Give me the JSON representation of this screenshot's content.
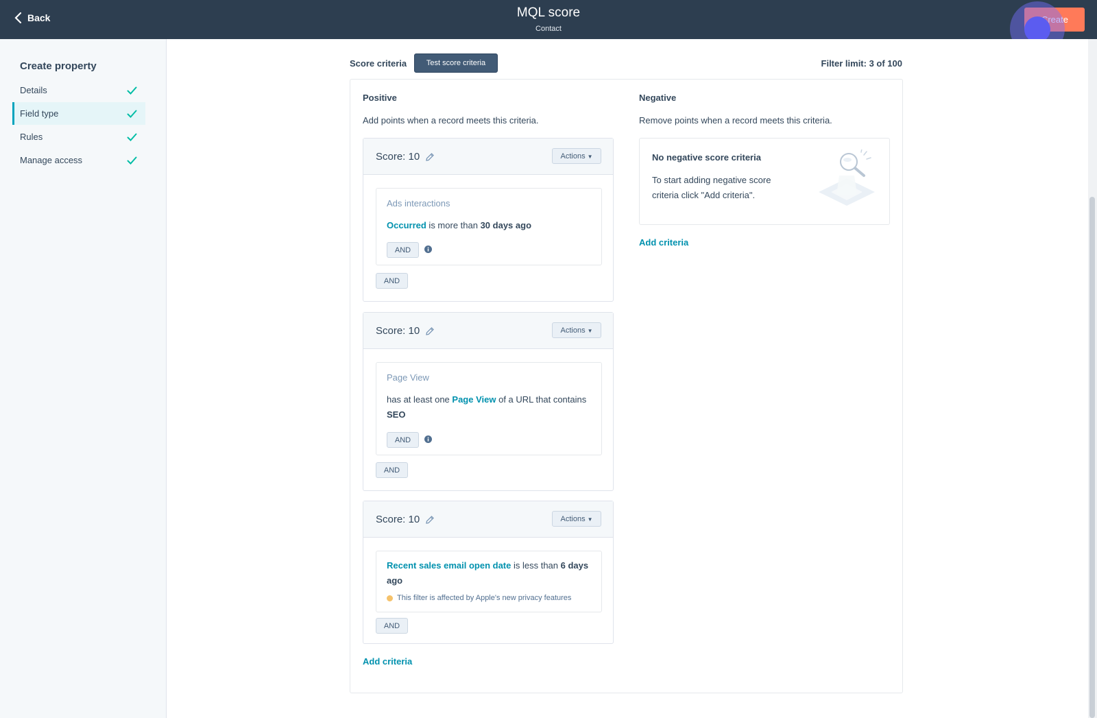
{
  "header": {
    "back_label": "Back",
    "title": "MQL score",
    "subtitle": "Contact",
    "create_label": "Create"
  },
  "sidebar": {
    "title": "Create property",
    "items": [
      {
        "label": "Details",
        "complete": true
      },
      {
        "label": "Field type",
        "complete": true,
        "active": true
      },
      {
        "label": "Rules",
        "complete": true
      },
      {
        "label": "Manage access",
        "complete": true
      }
    ]
  },
  "toolbar": {
    "score_criteria_label": "Score criteria",
    "test_button_label": "Test score criteria",
    "filter_limit": "Filter limit: 3 of 100"
  },
  "positive": {
    "heading": "Positive",
    "description": "Add points when a record meets this criteria.",
    "add_criteria_label": "Add criteria",
    "groups": [
      {
        "score_label": "Score: 10",
        "actions_label": "Actions",
        "filter": {
          "name": "Ads interactions",
          "link": "Occurred",
          "text": " is more than ",
          "value": "30 days ago",
          "inner_and": "AND"
        },
        "outer_and": "AND"
      },
      {
        "score_label": "Score: 10",
        "actions_label": "Actions",
        "filter": {
          "name": "Page View",
          "pre": "has at least one ",
          "link": "Page View",
          "text": " of a URL that contains ",
          "value": "SEO",
          "inner_and": "AND"
        },
        "outer_and": "AND"
      },
      {
        "score_label": "Score: 10",
        "actions_label": "Actions",
        "filter": {
          "link": "Recent sales email open date",
          "text": " is less than ",
          "value": "6 days ago",
          "warning": "This filter is affected by Apple's new privacy features"
        },
        "outer_and": "AND"
      }
    ]
  },
  "negative": {
    "heading": "Negative",
    "description": "Remove points when a record meets this criteria.",
    "empty_title": "No negative score criteria",
    "empty_desc": "To start adding negative score criteria click \"Add criteria\".",
    "add_criteria_label": "Add criteria"
  },
  "colors": {
    "header_bg": "#2d3e50",
    "accent": "#0091ae",
    "create_button": "#ff7a59",
    "check": "#00bda5"
  }
}
